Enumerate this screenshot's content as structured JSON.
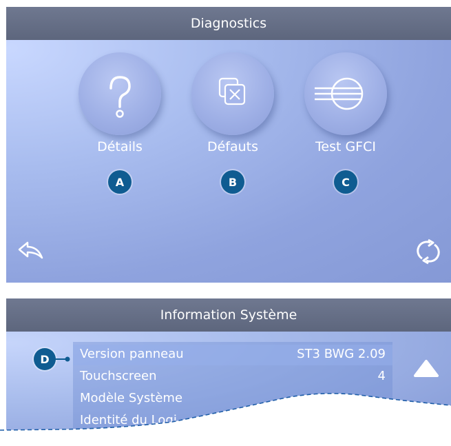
{
  "diagnostics": {
    "title": "Diagnostics",
    "items": [
      {
        "label": "Détails",
        "icon": "question-icon",
        "marker": "A"
      },
      {
        "label": "Défauts",
        "icon": "faults-icon",
        "marker": "B"
      },
      {
        "label": "Test GFCI",
        "icon": "gfci-icon",
        "marker": "C"
      }
    ],
    "back_icon": "back-arrow-icon",
    "refresh_icon": "refresh-icon"
  },
  "system_info": {
    "title": "Information Système",
    "marker": "D",
    "rows": [
      {
        "key": "Version panneau",
        "value": "ST3 BWG 2.09"
      },
      {
        "key": "Touchscreen",
        "value": "4"
      },
      {
        "key": "Modèle Système",
        "value": ""
      },
      {
        "key": "Identité du Logi",
        "value": ""
      }
    ],
    "scroll_up_icon": "scroll-up-icon"
  },
  "colors": {
    "titlebar": "#636c83",
    "marker": "#0f5c91",
    "panel_light": "#c9d8ff",
    "panel_dark": "#8599d6"
  }
}
